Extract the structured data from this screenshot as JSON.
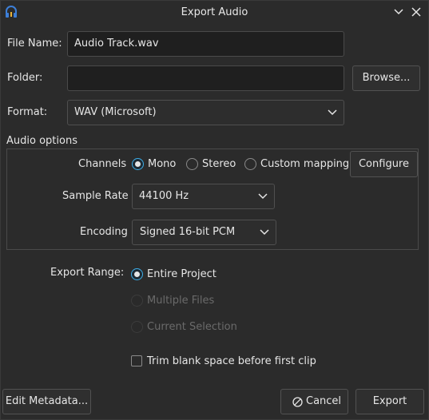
{
  "window": {
    "title": "Export Audio",
    "icons": {
      "app": "app-headphones-icon",
      "minimize": "chevron-down-icon",
      "close": "close-icon"
    }
  },
  "file_name": {
    "label": "File Name:",
    "value": "Audio Track.wav"
  },
  "folder": {
    "label": "Folder:",
    "value": "",
    "browse_label": "Browse..."
  },
  "format": {
    "label": "Format:",
    "selected": "WAV (Microsoft)"
  },
  "audio_options": {
    "title": "Audio options",
    "channels": {
      "label": "Channels",
      "options": [
        {
          "label": "Mono",
          "checked": true
        },
        {
          "label": "Stereo",
          "checked": false
        },
        {
          "label": "Custom mapping",
          "checked": false
        }
      ],
      "configure_label": "Configure"
    },
    "sample_rate": {
      "label": "Sample Rate",
      "selected": "44100 Hz"
    },
    "encoding": {
      "label": "Encoding",
      "selected": "Signed 16-bit PCM"
    }
  },
  "export_range": {
    "label": "Export Range:",
    "options": [
      {
        "label": "Entire Project",
        "checked": true,
        "enabled": true
      },
      {
        "label": "Multiple Files",
        "checked": false,
        "enabled": false
      },
      {
        "label": "Current Selection",
        "checked": false,
        "enabled": false
      }
    ]
  },
  "trim": {
    "label": "Trim blank space before first clip",
    "checked": false
  },
  "buttons": {
    "edit_metadata": "Edit Metadata...",
    "cancel": "Cancel",
    "export": "Export"
  },
  "colors": {
    "accent": "#3daee9",
    "background": "#2b2b2b",
    "field": "#1f1f1f"
  }
}
